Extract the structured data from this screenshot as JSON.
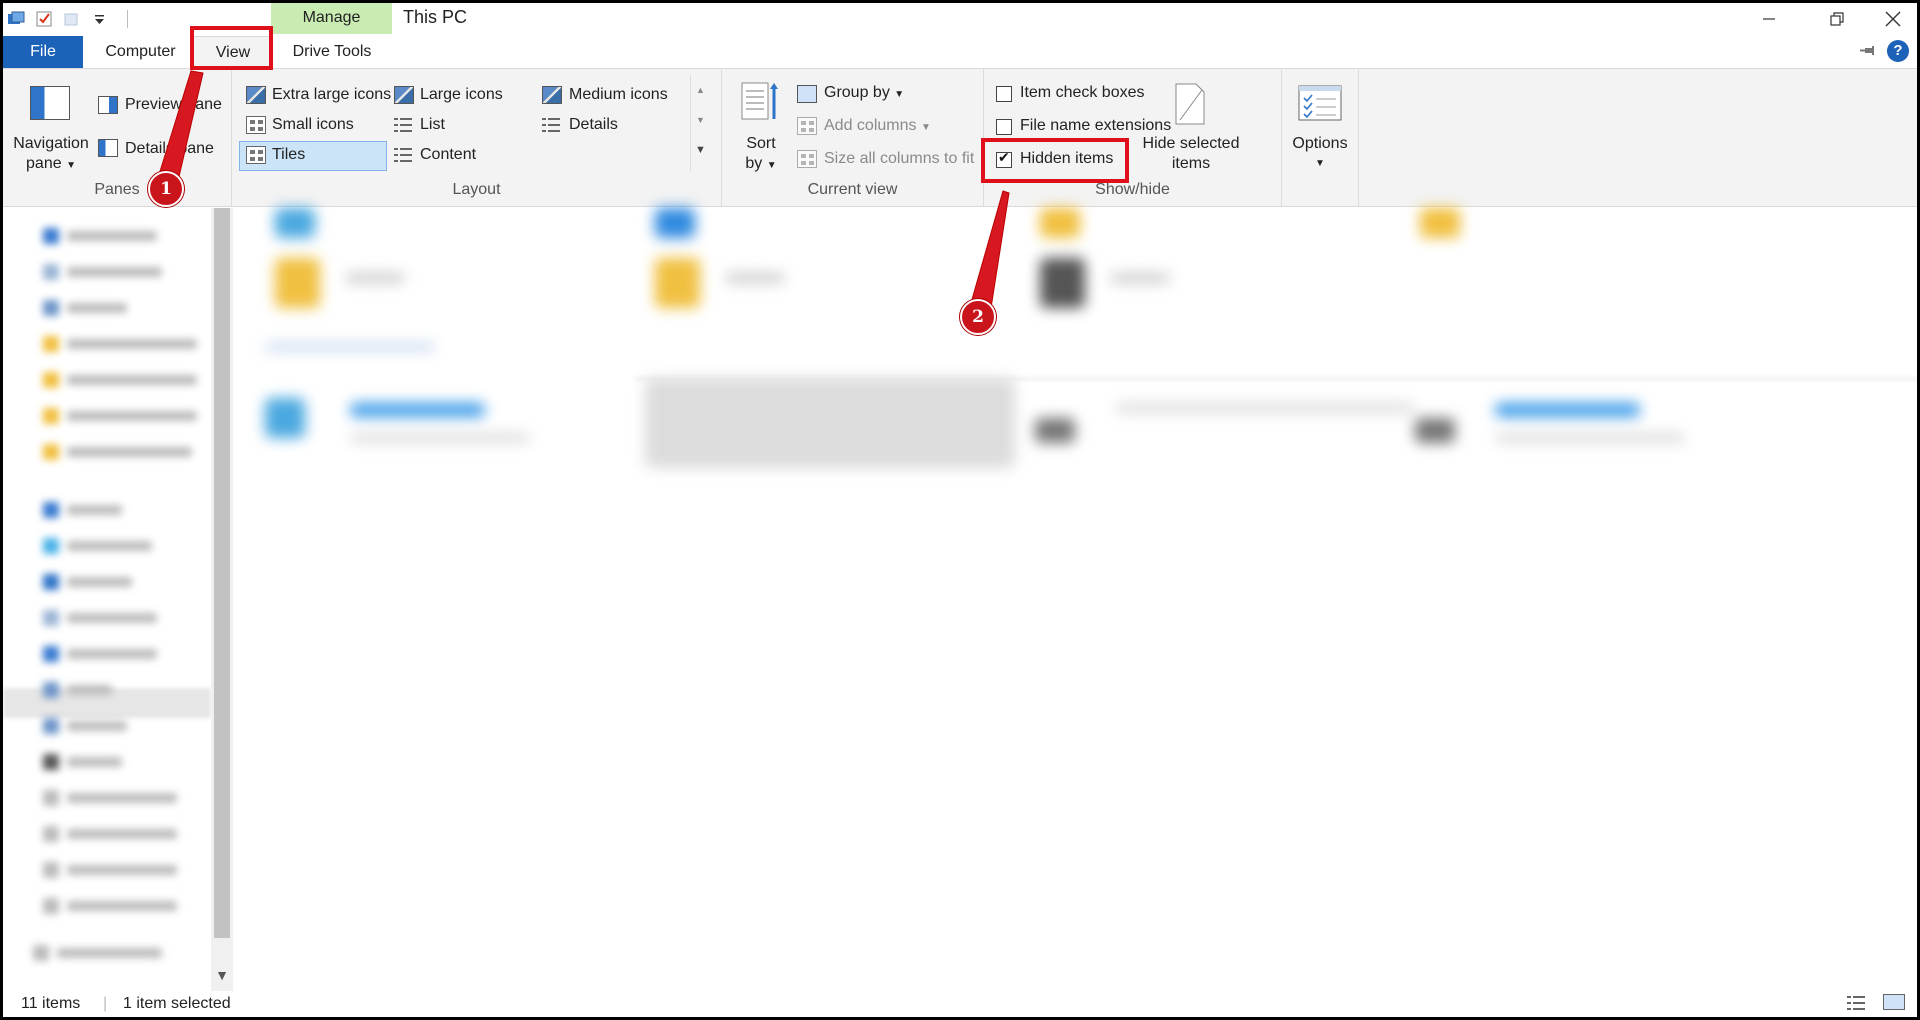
{
  "window": {
    "title": "This PC",
    "contextual_tab": "Manage"
  },
  "tabs": {
    "file": "File",
    "computer": "Computer",
    "view": "View",
    "drive_tools": "Drive Tools"
  },
  "ribbon": {
    "panes": {
      "label": "Panes",
      "navigation_pane": "Navigation",
      "navigation_pane_2": "pane",
      "preview_pane": "Preview pane",
      "details_pane": "Details pane"
    },
    "layout": {
      "label": "Layout",
      "extra_large_icons": "Extra large icons",
      "large_icons": "Large icons",
      "medium_icons": "Medium icons",
      "small_icons": "Small icons",
      "list": "List",
      "details": "Details",
      "tiles": "Tiles",
      "content": "Content"
    },
    "current_view": {
      "label": "Current view",
      "sort_by": "Sort",
      "sort_by_2": "by",
      "group_by": "Group by",
      "add_columns": "Add columns",
      "size_all_columns": "Size all columns to fit"
    },
    "show_hide": {
      "label": "Show/hide",
      "item_check_boxes": "Item check boxes",
      "file_name_extensions": "File name extensions",
      "hidden_items": "Hidden items",
      "hide_selected": "Hide selected",
      "hide_selected_2": "items"
    },
    "options": {
      "label": "Options"
    }
  },
  "checkboxes": {
    "item_check_boxes": false,
    "file_name_extensions": false,
    "hidden_items": true
  },
  "status": {
    "items": "11 items",
    "selected": "1 item selected"
  },
  "annotations": {
    "step1": "1",
    "step2": "2",
    "color": "#e0101a"
  },
  "colors": {
    "file_tab": "#1b62b8",
    "manage_tab": "#c9ecb3",
    "ribbon_bg": "#f3f3f3",
    "selected_layout": "#cce4f7"
  },
  "icons": {
    "qat": [
      "folder-icon",
      "properties-icon",
      "new-folder-icon",
      "customize-qat-icon"
    ],
    "window": [
      "minimize-icon",
      "restore-icon",
      "close-icon"
    ]
  }
}
